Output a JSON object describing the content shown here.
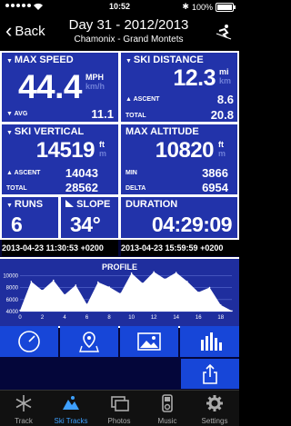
{
  "status": {
    "time": "10:52",
    "battery": "100%",
    "battery_level": 1.0
  },
  "nav": {
    "back_label": "Back",
    "title": "Day 31 - 2012/2013",
    "subtitle": "Chamonix - Grand Montets"
  },
  "max_speed": {
    "title": "MAX SPEED",
    "value": "44.4",
    "unit_primary": "MPH",
    "unit_secondary": "km/h",
    "avg_label": "AVG",
    "avg_value": "11.1"
  },
  "ski_distance": {
    "title": "SKI DISTANCE",
    "value": "12.3",
    "unit_primary": "mi",
    "unit_secondary": "km",
    "ascent_label": "ASCENT",
    "ascent_value": "8.6",
    "total_label": "TOTAL",
    "total_value": "20.8"
  },
  "ski_vertical": {
    "title": "SKI VERTICAL",
    "value": "14519",
    "unit_primary": "ft",
    "unit_secondary": "m",
    "ascent_label": "ASCENT",
    "ascent_value": "14043",
    "total_label": "TOTAL",
    "total_value": "28562"
  },
  "max_altitude": {
    "title": "MAX ALTITUDE",
    "value": "10820",
    "unit_primary": "ft",
    "unit_secondary": "m",
    "min_label": "MIN",
    "min_value": "3866",
    "delta_label": "DELTA",
    "delta_value": "6954"
  },
  "runs": {
    "title": "RUNS",
    "value": "6"
  },
  "slope": {
    "title": "SLOPE",
    "value": "34°"
  },
  "duration": {
    "title": "DURATION",
    "value": "04:29:09"
  },
  "timestamps": {
    "start": "2013-04-23 11:30:53 +0200",
    "end": "2013-04-23 15:59:59 +0200"
  },
  "chart_data": {
    "type": "area",
    "title": "PROFILE",
    "x": [
      0,
      1,
      2,
      3,
      4,
      5,
      6,
      7,
      8,
      9,
      10,
      11,
      12,
      13,
      14,
      15,
      16,
      17,
      18,
      19
    ],
    "y": [
      4200,
      9000,
      7500,
      9200,
      6800,
      8400,
      5200,
      8900,
      8100,
      7000,
      10400,
      8700,
      10600,
      9400,
      10500,
      9000,
      7200,
      8000,
      5100,
      4100
    ],
    "ylim": [
      4000,
      10500
    ],
    "yticks": [
      "10000",
      "8000",
      "6000",
      "4000"
    ],
    "xticks": [
      "0",
      "2",
      "4",
      "6",
      "8",
      "10",
      "12",
      "14",
      "16",
      "18"
    ],
    "grid": true,
    "colors": {
      "area": "#ffffff",
      "line": "#ffffff",
      "grid": "#5a6bd0"
    }
  },
  "buttons": [
    "speedometer-icon",
    "map-pin-icon",
    "photo-icon",
    "bar-chart-icon",
    "share-icon"
  ],
  "tabs": [
    {
      "label": "Track",
      "icon": "snowflake-icon"
    },
    {
      "label": "Ski Tracks",
      "icon": "mountain-icon",
      "active": true
    },
    {
      "label": "Photos",
      "icon": "photos-icon"
    },
    {
      "label": "Music",
      "icon": "ipod-icon"
    },
    {
      "label": "Settings",
      "icon": "gear-icon"
    }
  ],
  "colors": {
    "panel": "#2233aa",
    "background": "#04063a",
    "button": "#1746d8",
    "tab_active": "#3ea0ff"
  }
}
